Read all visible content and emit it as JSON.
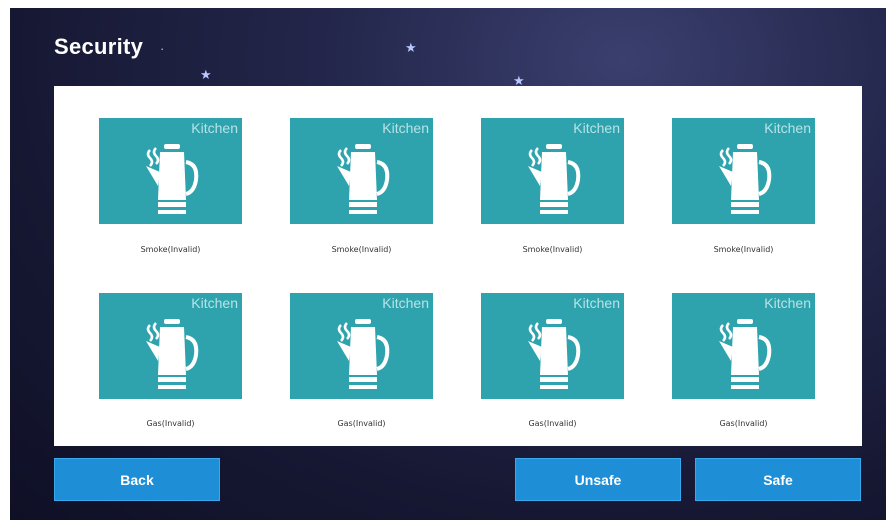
{
  "header": {
    "title": "Security"
  },
  "tiles": [
    {
      "room": "Kitchen",
      "label": "Smoke(Invalid)",
      "icon": "kettle-icon"
    },
    {
      "room": "Kitchen",
      "label": "Smoke(Invalid)",
      "icon": "kettle-icon"
    },
    {
      "room": "Kitchen",
      "label": "Smoke(Invalid)",
      "icon": "kettle-icon"
    },
    {
      "room": "Kitchen",
      "label": "Smoke(Invalid)",
      "icon": "kettle-icon"
    },
    {
      "room": "Kitchen",
      "label": "Gas(Invalid)",
      "icon": "kettle-icon"
    },
    {
      "room": "Kitchen",
      "label": "Gas(Invalid)",
      "icon": "kettle-icon"
    },
    {
      "room": "Kitchen",
      "label": "Gas(Invalid)",
      "icon": "kettle-icon"
    },
    {
      "room": "Kitchen",
      "label": "Gas(Invalid)",
      "icon": "kettle-icon"
    }
  ],
  "buttons": {
    "back": "Back",
    "unsafe": "Unsafe",
    "safe": "Safe"
  },
  "colors": {
    "tile": "#2ea3ad",
    "button": "#1e8fd6",
    "background": "#1a1c3a"
  }
}
